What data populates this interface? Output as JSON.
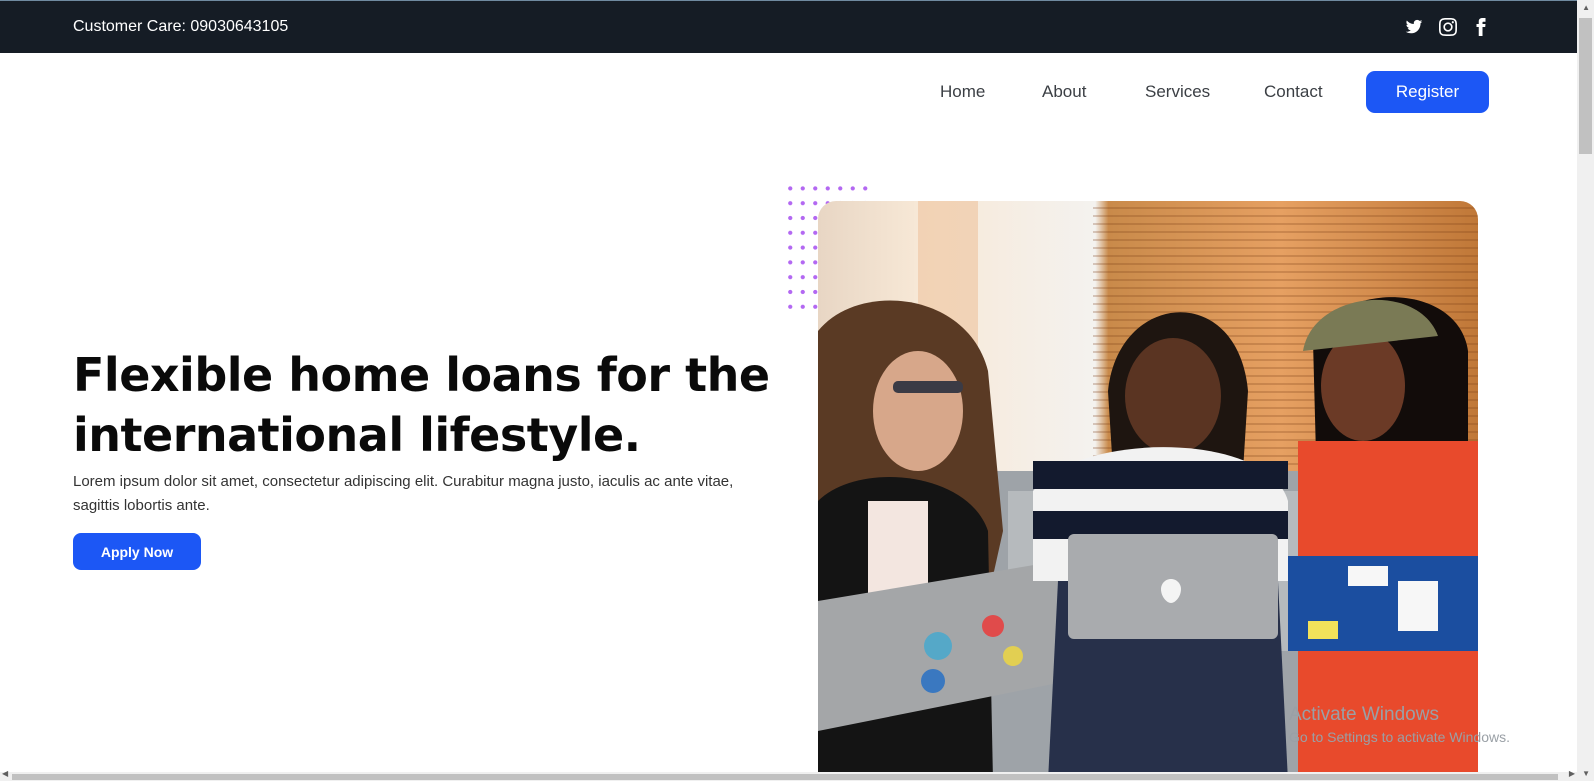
{
  "topbar": {
    "customer_care": "Customer Care: 09030643105",
    "social": [
      "twitter-icon",
      "instagram-icon",
      "facebook-icon"
    ]
  },
  "nav": {
    "links": [
      "Home",
      "About",
      "Services",
      "Contact"
    ],
    "register_label": "Register"
  },
  "hero": {
    "headline_line1": "Flexible home loans for the",
    "headline_line2": "international lifestyle.",
    "lede_line1": "Lorem ipsum dolor sit amet, consectetur adipiscing elit. Curabitur magna justo, iaculis ac ante vitae,",
    "lede_line2": "sagittis lobortis ante.",
    "cta_label": "Apply Now",
    "image_description": "three-women-with-laptops-photo"
  },
  "watermark": {
    "title": "Activate Windows",
    "subtitle": "Go to Settings to activate Windows."
  },
  "colors": {
    "topbar_bg": "#151c25",
    "accent": "#1c57f5",
    "dots": "#b368f2"
  }
}
